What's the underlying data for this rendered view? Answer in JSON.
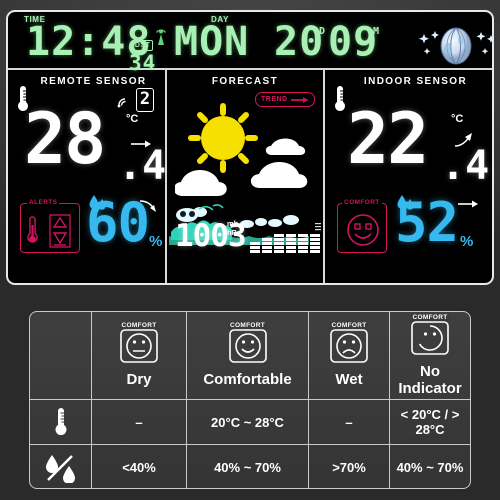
{
  "display": {
    "topbar": {
      "time_label": "TIME",
      "time_value": "12:48",
      "dst_label": "DST",
      "seconds_value": "34",
      "antenna_icon": "radio-signal-icon",
      "day_label": "DAY",
      "day_value": "MON",
      "date_value": "20",
      "date_suffix": "D",
      "month_value": "09",
      "month_suffix": "M",
      "moon_icon": "moon-phase-icon"
    },
    "remote": {
      "title": "REMOTE SENSOR",
      "thermometer_icon": "thermometer-icon",
      "signal_icon": "signal-waves-icon",
      "channel": "2",
      "temp_int": "28",
      "temp_dec": ".4",
      "unit": "°C",
      "trend_icon": "arrow-right-icon",
      "alerts_label": "ALERTS",
      "alerts_icon": "thermometer-alert-icon",
      "humidity": "60",
      "humidity_unit": "%",
      "drop_icon": "water-drops-icon",
      "hum_trend_icon": "arrow-down-right-icon"
    },
    "forecast": {
      "title": "FORECAST",
      "trend_label": "TREND",
      "trend_arrow_icon": "arrow-right-icon",
      "weather_icon": "sun-behind-clouds-icon",
      "storm_icon": "storm-waves-icon",
      "pressure": "1003",
      "pressure_unit_1": "mb",
      "pressure_unit_2": "hPa",
      "history_chart_icon": "pressure-history-bars-icon"
    },
    "indoor": {
      "title": "INDOOR SENSOR",
      "thermometer_icon": "thermometer-icon",
      "temp_int": "22",
      "temp_dec": ".4",
      "unit": "°C",
      "trend_icon": "arrow-up-right-icon",
      "comfort_label": "COMFORT",
      "comfort_face_icon": "smiley-face-icon",
      "humidity": "52",
      "humidity_unit": "%",
      "drop_icon": "water-drops-icon",
      "hum_trend_icon": "arrow-right-icon"
    }
  },
  "legend": {
    "comfort_caption": "COMFORT",
    "columns": [
      {
        "label": "Dry",
        "face": "neutral",
        "temp": "–",
        "humidity": "<40%"
      },
      {
        "label": "Comfortable",
        "face": "smile",
        "temp": "20°C ~ 28°C",
        "humidity": "40% ~ 70%"
      },
      {
        "label": "Wet",
        "face": "frown",
        "temp": "–",
        "humidity": ">70%"
      },
      {
        "label": "No Indicator",
        "face": "none",
        "temp": "< 20°C / > 28°C",
        "humidity": "40% ~ 70%"
      }
    ],
    "row_icons": {
      "temperature": "thermometer-icon",
      "humidity": "humidity-percent-icon"
    }
  },
  "colors": {
    "lcd_green": "#a9f0b4",
    "lcd_white": "#ffffff",
    "humidity_cyan": "#35b9ef",
    "alert_magenta": "#d4135f",
    "sun_yellow": "#f5e000",
    "background": "#363636"
  }
}
